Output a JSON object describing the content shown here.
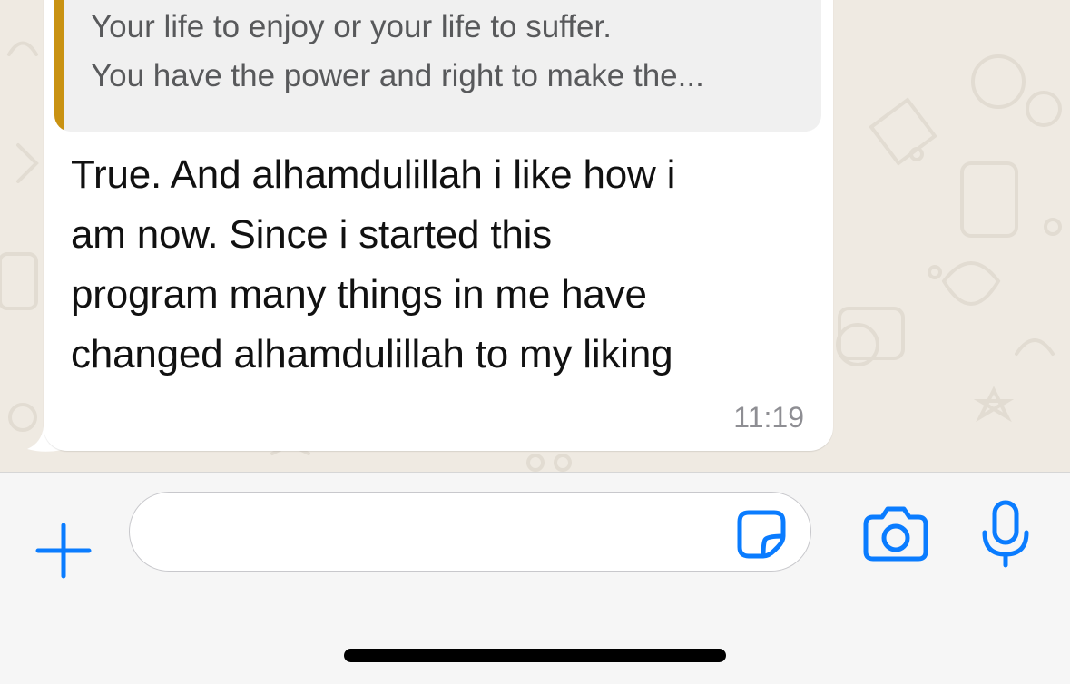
{
  "chat": {
    "quoted_message": {
      "lines": [
        "Your life to enjoy or your life to suffer.",
        "You have the power and right to make the..."
      ],
      "accent_color": "#c99212"
    },
    "message": {
      "lines": [
        "True. And alhamdulillah i like how i",
        "am now. Since i started this",
        "program many things in me have",
        "changed alhamdulillah to my liking"
      ],
      "time": "11:19"
    },
    "wallpaper_color": "#efeae2"
  },
  "input_bar": {
    "attach_icon": "plus-icon",
    "message_field": {
      "value": "",
      "placeholder": ""
    },
    "sticker_icon": "sticker-icon",
    "camera_icon": "camera-icon",
    "mic_icon": "microphone-icon",
    "accent_color": "#0a7cff"
  }
}
